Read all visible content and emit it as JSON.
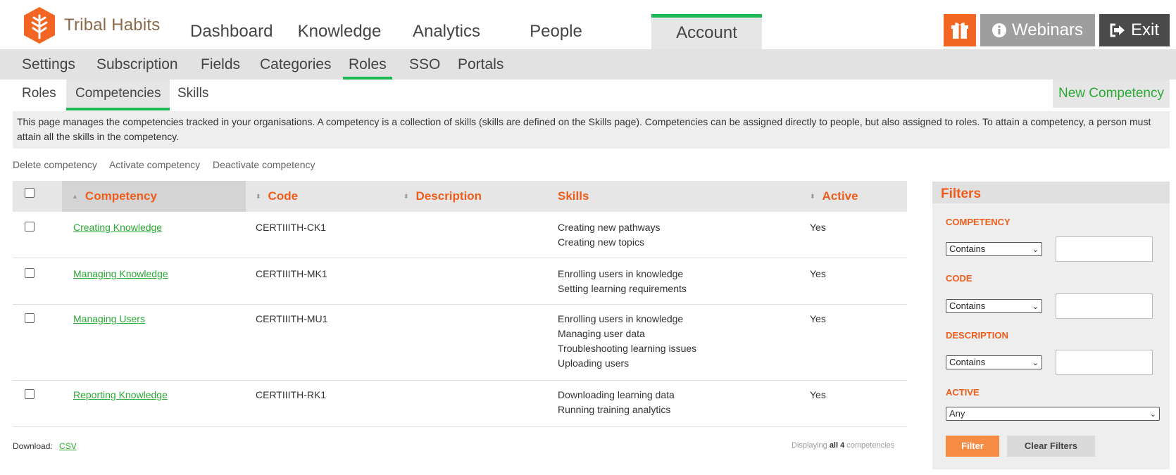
{
  "brand": {
    "name": "Tribal Habits",
    "color": "#f26522"
  },
  "main_nav": [
    {
      "label": "Dashboard",
      "active": false
    },
    {
      "label": "Knowledge",
      "active": false
    },
    {
      "label": "Analytics",
      "active": false
    },
    {
      "label": "People",
      "active": false
    },
    {
      "label": "Account",
      "active": true
    }
  ],
  "header_buttons": {
    "gift_icon": "gift-icon",
    "webinars": "Webinars",
    "exit": "Exit"
  },
  "sub_nav": [
    {
      "label": "Settings"
    },
    {
      "label": "Subscription"
    },
    {
      "label": "Fields"
    },
    {
      "label": "Categories"
    },
    {
      "label": "Roles",
      "active": true
    },
    {
      "label": "SSO"
    },
    {
      "label": "Portals"
    }
  ],
  "tabs": [
    {
      "label": "Roles"
    },
    {
      "label": "Competencies",
      "active": true
    },
    {
      "label": "Skills"
    }
  ],
  "new_button": "New Competency",
  "info_text": "This page manages the competencies tracked in your organisations. A competency is a collection of skills (skills are defined on the Skills page). Competencies can be assigned directly to people, but also assigned to roles. To attain a competency, a person must attain all the skills in the competency.",
  "actions": [
    "Delete competency",
    "Activate competency",
    "Deactivate competency"
  ],
  "table": {
    "headers": {
      "competency": "Competency",
      "code": "Code",
      "description": "Description",
      "skills": "Skills",
      "active": "Active"
    },
    "rows": [
      {
        "competency": "Creating Knowledge",
        "code": "CERTIIITH-CK1",
        "description": "",
        "skills": [
          "Creating new pathways",
          "Creating new topics"
        ],
        "active": "Yes"
      },
      {
        "competency": "Managing Knowledge",
        "code": "CERTIIITH-MK1",
        "description": "",
        "skills": [
          "Enrolling users in knowledge",
          "Setting learning requirements"
        ],
        "active": "Yes"
      },
      {
        "competency": "Managing Users",
        "code": "CERTIIITH-MU1",
        "description": "",
        "skills": [
          "Enrolling users in knowledge",
          "Managing user data",
          "Troubleshooting learning issues",
          "Uploading users"
        ],
        "active": "Yes"
      },
      {
        "competency": "Reporting Knowledge",
        "code": "CERTIIITH-RK1",
        "description": "",
        "skills": [
          "Downloading learning data",
          "Running training analytics"
        ],
        "active": "Yes"
      }
    ]
  },
  "footer": {
    "download_label": "Download:",
    "csv": "CSV",
    "displaying_prefix": "Displaying",
    "displaying_all": "all 4",
    "displaying_suffix": "competencies"
  },
  "filters": {
    "title": "Filters",
    "competency_label": "COMPETENCY",
    "code_label": "CODE",
    "description_label": "DESCRIPTION",
    "active_label": "ACTIVE",
    "contains": "Contains",
    "any": "Any",
    "filter_button": "Filter",
    "clear_button": "Clear Filters"
  }
}
